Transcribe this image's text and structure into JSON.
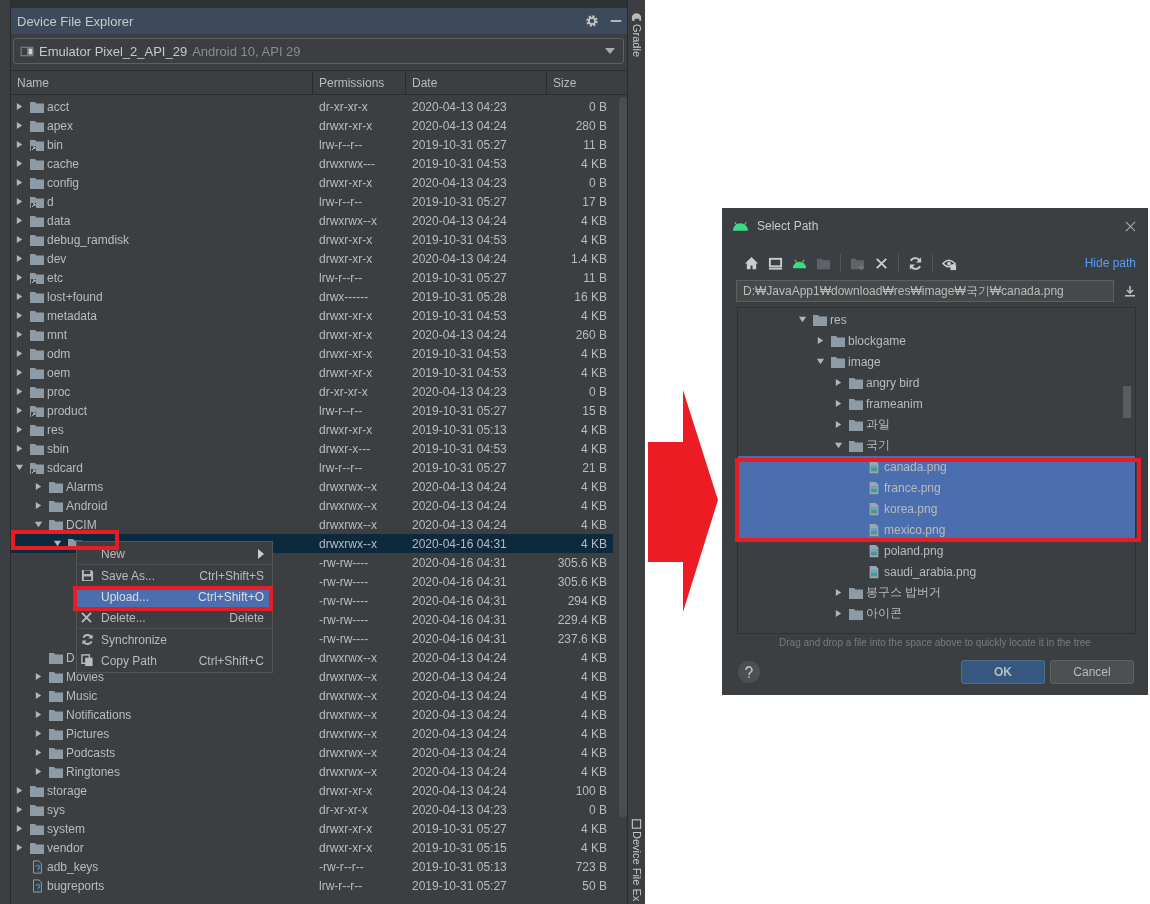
{
  "window": {
    "title": "Device File Explorer"
  },
  "device": {
    "name": "Emulator Pixel_2_API_29",
    "detail": "Android 10, API 29"
  },
  "table": {
    "columns": [
      "Name",
      "Permissions",
      "Date",
      "Size"
    ],
    "rows": [
      {
        "name": "acct",
        "kind": "folder",
        "permissions": "dr-xr-xr-x",
        "date": "2020-04-13 04:23",
        "size": "0 B",
        "expanded": false,
        "selected": false
      },
      {
        "name": "apex",
        "kind": "folder",
        "permissions": "drwxr-xr-x",
        "date": "2020-04-13 04:24",
        "size": "280 B",
        "expanded": false,
        "selected": false
      },
      {
        "name": "bin",
        "kind": "link",
        "permissions": "lrw-r--r--",
        "date": "2019-10-31 05:27",
        "size": "11 B",
        "expanded": false,
        "selected": false
      },
      {
        "name": "cache",
        "kind": "folder",
        "permissions": "drwxrwx---",
        "date": "2019-10-31 04:53",
        "size": "4 KB",
        "expanded": false,
        "selected": false
      },
      {
        "name": "config",
        "kind": "folder",
        "permissions": "drwxr-xr-x",
        "date": "2020-04-13 04:23",
        "size": "0 B",
        "expanded": false,
        "selected": false
      },
      {
        "name": "d",
        "kind": "link",
        "permissions": "lrw-r--r--",
        "date": "2019-10-31 05:27",
        "size": "17 B",
        "expanded": false,
        "selected": false
      },
      {
        "name": "data",
        "kind": "folder",
        "permissions": "drwxrwx--x",
        "date": "2020-04-13 04:24",
        "size": "4 KB",
        "expanded": false,
        "selected": false
      },
      {
        "name": "debug_ramdisk",
        "kind": "folder",
        "permissions": "drwxr-xr-x",
        "date": "2019-10-31 04:53",
        "size": "4 KB",
        "expanded": false,
        "selected": false
      },
      {
        "name": "dev",
        "kind": "folder",
        "permissions": "drwxr-xr-x",
        "date": "2020-04-13 04:24",
        "size": "1.4 KB",
        "expanded": false,
        "selected": false
      },
      {
        "name": "etc",
        "kind": "link",
        "permissions": "lrw-r--r--",
        "date": "2019-10-31 05:27",
        "size": "11 B",
        "expanded": false,
        "selected": false
      },
      {
        "name": "lost+found",
        "kind": "folder",
        "permissions": "drwx------",
        "date": "2019-10-31 05:28",
        "size": "16 KB",
        "expanded": false,
        "selected": false
      },
      {
        "name": "metadata",
        "kind": "folder",
        "permissions": "drwxr-xr-x",
        "date": "2019-10-31 04:53",
        "size": "4 KB",
        "expanded": false,
        "selected": false
      },
      {
        "name": "mnt",
        "kind": "folder",
        "permissions": "drwxr-xr-x",
        "date": "2020-04-13 04:24",
        "size": "260 B",
        "expanded": false,
        "selected": false
      },
      {
        "name": "odm",
        "kind": "folder",
        "permissions": "drwxr-xr-x",
        "date": "2019-10-31 04:53",
        "size": "4 KB",
        "expanded": false,
        "selected": false
      },
      {
        "name": "oem",
        "kind": "folder",
        "permissions": "drwxr-xr-x",
        "date": "2019-10-31 04:53",
        "size": "4 KB",
        "expanded": false,
        "selected": false
      },
      {
        "name": "proc",
        "kind": "folder",
        "permissions": "dr-xr-xr-x",
        "date": "2020-04-13 04:23",
        "size": "0 B",
        "expanded": false,
        "selected": false
      },
      {
        "name": "product",
        "kind": "link",
        "permissions": "lrw-r--r--",
        "date": "2019-10-31 05:27",
        "size": "15 B",
        "expanded": false,
        "selected": false
      },
      {
        "name": "res",
        "kind": "folder",
        "permissions": "drwxr-xr-x",
        "date": "2019-10-31 05:13",
        "size": "4 KB",
        "expanded": false,
        "selected": false
      },
      {
        "name": "sbin",
        "kind": "folder",
        "permissions": "drwxr-x---",
        "date": "2019-10-31 04:53",
        "size": "4 KB",
        "expanded": false,
        "selected": false
      },
      {
        "name": "sdcard",
        "kind": "link",
        "permissions": "lrw-r--r--",
        "date": "2019-10-31 05:27",
        "size": "21 B",
        "expanded": true,
        "selected": false,
        "children": [
          {
            "name": "Alarms",
            "kind": "folder",
            "permissions": "drwxrwx--x",
            "date": "2020-04-13 04:24",
            "size": "4 KB",
            "expanded": false,
            "selected": false
          },
          {
            "name": "Android",
            "kind": "folder",
            "permissions": "drwxrwx--x",
            "date": "2020-04-13 04:24",
            "size": "4 KB",
            "expanded": false,
            "selected": false
          },
          {
            "name": "DCIM",
            "kind": "folder",
            "permissions": "drwxrwx--x",
            "date": "2020-04-13 04:24",
            "size": "4 KB",
            "expanded": true,
            "selected": false,
            "children": [
              {
                "kind": "folder",
                "permissions": "drwxrwx--x",
                "date": "2020-04-16 04:31",
                "size": "4 KB",
                "expanded": true,
                "selected": true,
                "children": [
                  {
                    "permissions": "-rw-rw----",
                    "date": "2020-04-16 04:31",
                    "size": "305.6 KB",
                    "selected": false
                  },
                  {
                    "permissions": "-rw-rw----",
                    "date": "2020-04-16 04:31",
                    "size": "305.6 KB",
                    "selected": false
                  },
                  {
                    "permissions": "-rw-rw----",
                    "date": "2020-04-16 04:31",
                    "size": "294 KB",
                    "selected": false
                  },
                  {
                    "permissions": "-rw-rw----",
                    "date": "2020-04-16 04:31",
                    "size": "229.4 KB",
                    "selected": false
                  },
                  {
                    "permissions": "-rw-rw----",
                    "date": "2020-04-16 04:31",
                    "size": "237.6 KB",
                    "selected": false
                  }
                ]
              }
            ]
          },
          {
            "name": "D",
            "kind": "folder",
            "permissions": "drwxrwx--x",
            "date": "2020-04-13 04:24",
            "size": "4 KB",
            "selected": false
          },
          {
            "name": "Movies",
            "kind": "folder",
            "permissions": "drwxrwx--x",
            "date": "2020-04-13 04:24",
            "size": "4 KB",
            "expanded": false,
            "selected": false
          },
          {
            "name": "Music",
            "kind": "folder",
            "permissions": "drwxrwx--x",
            "date": "2020-04-13 04:24",
            "size": "4 KB",
            "expanded": false,
            "selected": false
          },
          {
            "name": "Notifications",
            "kind": "folder",
            "permissions": "drwxrwx--x",
            "date": "2020-04-13 04:24",
            "size": "4 KB",
            "expanded": false,
            "selected": false
          },
          {
            "name": "Pictures",
            "kind": "folder",
            "permissions": "drwxrwx--x",
            "date": "2020-04-13 04:24",
            "size": "4 KB",
            "expanded": false,
            "selected": false
          },
          {
            "name": "Podcasts",
            "kind": "folder",
            "permissions": "drwxrwx--x",
            "date": "2020-04-13 04:24",
            "size": "4 KB",
            "expanded": false,
            "selected": false
          },
          {
            "name": "Ringtones",
            "kind": "folder",
            "permissions": "drwxrwx--x",
            "date": "2020-04-13 04:24",
            "size": "4 KB",
            "expanded": false,
            "selected": false
          }
        ]
      },
      {
        "name": "storage",
        "kind": "folder",
        "permissions": "drwxr-xr-x",
        "date": "2020-04-13 04:24",
        "size": "100 B",
        "expanded": false,
        "selected": false
      },
      {
        "name": "sys",
        "kind": "folder",
        "permissions": "dr-xr-xr-x",
        "date": "2020-04-13 04:23",
        "size": "0 B",
        "expanded": false,
        "selected": false
      },
      {
        "name": "system",
        "kind": "folder",
        "permissions": "drwxr-xr-x",
        "date": "2019-10-31 05:27",
        "size": "4 KB",
        "expanded": false,
        "selected": false
      },
      {
        "name": "vendor",
        "kind": "folder",
        "permissions": "drwxr-xr-x",
        "date": "2019-10-31 05:15",
        "size": "4 KB",
        "expanded": false,
        "selected": false
      },
      {
        "name": "adb_keys",
        "kind": "file",
        "permissions": "-rw-r--r--",
        "date": "2019-10-31 05:13",
        "size": "723 B",
        "selected": false
      },
      {
        "name": "bugreports",
        "kind": "file",
        "permissions": "lrw-r--r--",
        "date": "2019-10-31 05:27",
        "size": "50 B",
        "selected": false
      }
    ]
  },
  "context_menu": {
    "items": [
      {
        "label": "New",
        "submenu": true,
        "selected": false,
        "separator_after": true
      },
      {
        "label": "Save As...",
        "shortcut": "Ctrl+Shift+S",
        "submenu": false,
        "selected": false,
        "separator_after": false
      },
      {
        "label": "Upload...",
        "shortcut": "Ctrl+Shift+O",
        "submenu": false,
        "selected": true,
        "separator_after": false
      },
      {
        "label": "Delete...",
        "shortcut": "Delete",
        "submenu": false,
        "selected": false,
        "separator_after": true
      },
      {
        "label": "Synchronize",
        "submenu": false,
        "selected": false,
        "separator_after": false
      },
      {
        "label": "Copy Path",
        "shortcut": "Ctrl+Shift+C",
        "submenu": false,
        "selected": false,
        "separator_after": false
      }
    ]
  },
  "side_tabs": [
    "Gradle",
    "Device File Ex"
  ],
  "dialog": {
    "title": "Select Path",
    "toolbar": [
      {
        "disabled": false
      },
      {
        "disabled": false
      },
      {
        "disabled": false
      },
      {
        "disabled": true
      },
      {
        "disabled": true
      },
      {
        "disabled": false
      },
      {
        "disabled": false
      },
      {
        "disabled": false
      }
    ],
    "hide_path": "Hide path",
    "path": "D:₩JavaApp1₩download₩res₩image₩국기₩canada.png",
    "tree": [
      {
        "name": "res",
        "kind": "folder",
        "expanded": true,
        "selected": false,
        "children": [
          {
            "name": "blockgame",
            "kind": "folder",
            "expanded": false,
            "selected": false
          },
          {
            "name": "image",
            "kind": "folder",
            "expanded": true,
            "selected": false,
            "children": [
              {
                "name": "angry bird",
                "kind": "folder",
                "expanded": false,
                "selected": false
              },
              {
                "name": "frameanim",
                "kind": "folder",
                "expanded": false,
                "selected": false
              },
              {
                "name": "과일",
                "kind": "folder",
                "expanded": false,
                "selected": false
              },
              {
                "name": "국기",
                "kind": "folder",
                "expanded": true,
                "selected": false,
                "children": [
                  {
                    "name": "canada.png",
                    "kind": "image",
                    "selected": true
                  },
                  {
                    "name": "france.png",
                    "kind": "image",
                    "selected": true
                  },
                  {
                    "name": "korea.png",
                    "kind": "image",
                    "selected": true
                  },
                  {
                    "name": "mexico.png",
                    "kind": "image",
                    "selected": true
                  },
                  {
                    "name": "poland.png",
                    "kind": "image",
                    "selected": false
                  },
                  {
                    "name": "saudi_arabia.png",
                    "kind": "image",
                    "selected": false
                  }
                ]
              },
              {
                "name": "봉구스 밥버거",
                "kind": "folder",
                "expanded": false,
                "selected": false
              },
              {
                "name": "아이콘",
                "kind": "folder",
                "expanded": false,
                "selected": false
              }
            ]
          }
        ]
      }
    ],
    "hint": "Drag and drop a file into the space above to quickly locate it in the tree",
    "buttons": [
      "OK",
      "Cancel"
    ]
  }
}
